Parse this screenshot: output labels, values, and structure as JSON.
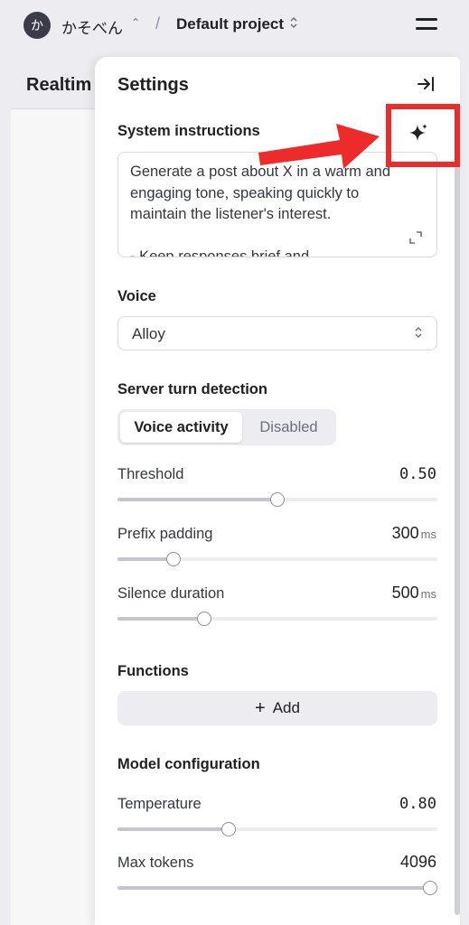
{
  "header": {
    "avatar_letter": "か",
    "org_name": "かそべん",
    "separator": "/",
    "project_name": "Default project"
  },
  "background_panel": {
    "title": "Realtim"
  },
  "settings": {
    "title": "Settings",
    "system_instructions": {
      "label": "System instructions",
      "text": "Generate a post about X in a warm and engaging tone, speaking quickly to maintain the listener's interest.\n\n- Keep responses brief and"
    },
    "voice": {
      "label": "Voice",
      "selected": "Alloy"
    },
    "turn_detection": {
      "label": "Server turn detection",
      "options": [
        "Voice activity",
        "Disabled"
      ],
      "selected": "Voice activity",
      "threshold": {
        "label": "Threshold",
        "value": "0.50",
        "fraction": 0.5
      },
      "prefix_padding": {
        "label": "Prefix padding",
        "value": "300",
        "unit": "ms",
        "fraction": 0.16
      },
      "silence_duration": {
        "label": "Silence duration",
        "value": "500",
        "unit": "ms",
        "fraction": 0.26
      }
    },
    "functions": {
      "label": "Functions",
      "add_label": "Add"
    },
    "model_configuration": {
      "label": "Model configuration",
      "temperature": {
        "label": "Temperature",
        "value": "0.80",
        "fraction": 0.34
      },
      "max_tokens": {
        "label": "Max tokens",
        "value": "4096",
        "fraction": 1.0
      }
    }
  },
  "colors": {
    "annotation_red": "#ee2b2b",
    "background": "#ececf1",
    "panel": "#ffffff"
  }
}
